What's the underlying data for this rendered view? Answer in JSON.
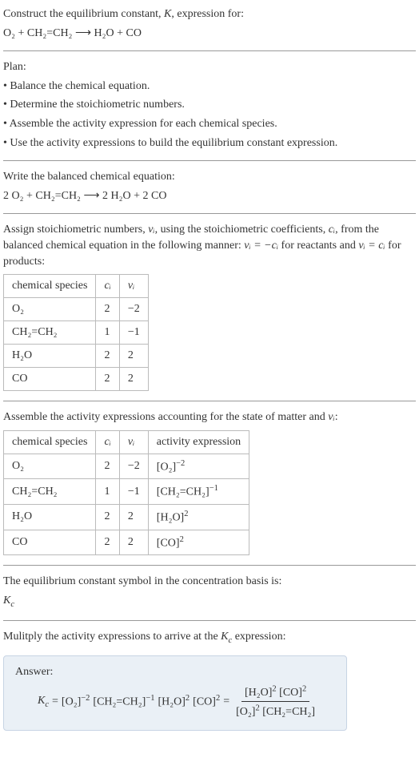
{
  "intro": {
    "line1_pre": "Construct the equilibrium constant, ",
    "K": "K",
    "line1_post": ", expression for:",
    "eqn_lhs": "O₂ + CH₂=CH₂",
    "arrow": "⟶",
    "eqn_rhs": "H₂O + CO"
  },
  "plan": {
    "heading": "Plan:",
    "b1": "• Balance the chemical equation.",
    "b2": "• Determine the stoichiometric numbers.",
    "b3": "• Assemble the activity expression for each chemical species.",
    "b4": "• Use the activity expressions to build the equilibrium constant expression."
  },
  "balanced": {
    "heading": "Write the balanced chemical equation:",
    "lhs": "2 O₂ + CH₂=CH₂",
    "arrow": "⟶",
    "rhs": "2 H₂O + 2 CO"
  },
  "stoich": {
    "text_a": "Assign stoichiometric numbers, ",
    "nu_i": "νᵢ",
    "text_b": ", using the stoichiometric coefficients, ",
    "c_i": "cᵢ",
    "text_c": ", from the balanced chemical equation in the following manner: ",
    "rel1": "νᵢ = −cᵢ",
    "text_d": " for reactants and ",
    "rel2": "νᵢ = cᵢ",
    "text_e": " for products:",
    "table": {
      "h1": "chemical species",
      "h2": "cᵢ",
      "h3": "νᵢ",
      "rows": [
        {
          "sp": "O₂",
          "c": "2",
          "n": "−2"
        },
        {
          "sp": "CH₂=CH₂",
          "c": "1",
          "n": "−1"
        },
        {
          "sp": "H₂O",
          "c": "2",
          "n": "2"
        },
        {
          "sp": "CO",
          "c": "2",
          "n": "2"
        }
      ]
    }
  },
  "activity": {
    "text_a": "Assemble the activity expressions accounting for the state of matter and ",
    "nu_i": "νᵢ",
    "text_b": ":",
    "table": {
      "h1": "chemical species",
      "h2": "cᵢ",
      "h3": "νᵢ",
      "h4": "activity expression",
      "rows": [
        {
          "sp": "O₂",
          "c": "2",
          "n": "−2",
          "a_base": "[O₂]",
          "a_exp": "−2"
        },
        {
          "sp": "CH₂=CH₂",
          "c": "1",
          "n": "−1",
          "a_base": "[CH₂=CH₂]",
          "a_exp": "−1"
        },
        {
          "sp": "H₂O",
          "c": "2",
          "n": "2",
          "a_base": "[H₂O]",
          "a_exp": "2"
        },
        {
          "sp": "CO",
          "c": "2",
          "n": "2",
          "a_base": "[CO]",
          "a_exp": "2"
        }
      ]
    }
  },
  "symbol": {
    "line": "The equilibrium constant symbol in the concentration basis is:",
    "kc": "K",
    "kc_sub": "c"
  },
  "final": {
    "line": "Mulitply the activity expressions to arrive at the ",
    "kc": "K",
    "kc_sub": "c",
    "line_post": " expression:",
    "answer_label": "Answer:",
    "eq_lhs_K": "K",
    "eq_lhs_sub": "c",
    "eq_equals": " = ",
    "t1_base": "[O₂]",
    "t1_exp": "−2",
    "t2_base": "[CH₂=CH₂]",
    "t2_exp": "−1",
    "t3_base": "[H₂O]",
    "t3_exp": "2",
    "t4_base": "[CO]",
    "t4_exp": "2",
    "eq_equals2": " = ",
    "num1_base": "[H₂O]",
    "num1_exp": "2",
    "num2_base": "[CO]",
    "num2_exp": "2",
    "den1_base": "[O₂]",
    "den1_exp": "2",
    "den2_base": "[CH₂=CH₂]",
    "den2_exp": ""
  }
}
